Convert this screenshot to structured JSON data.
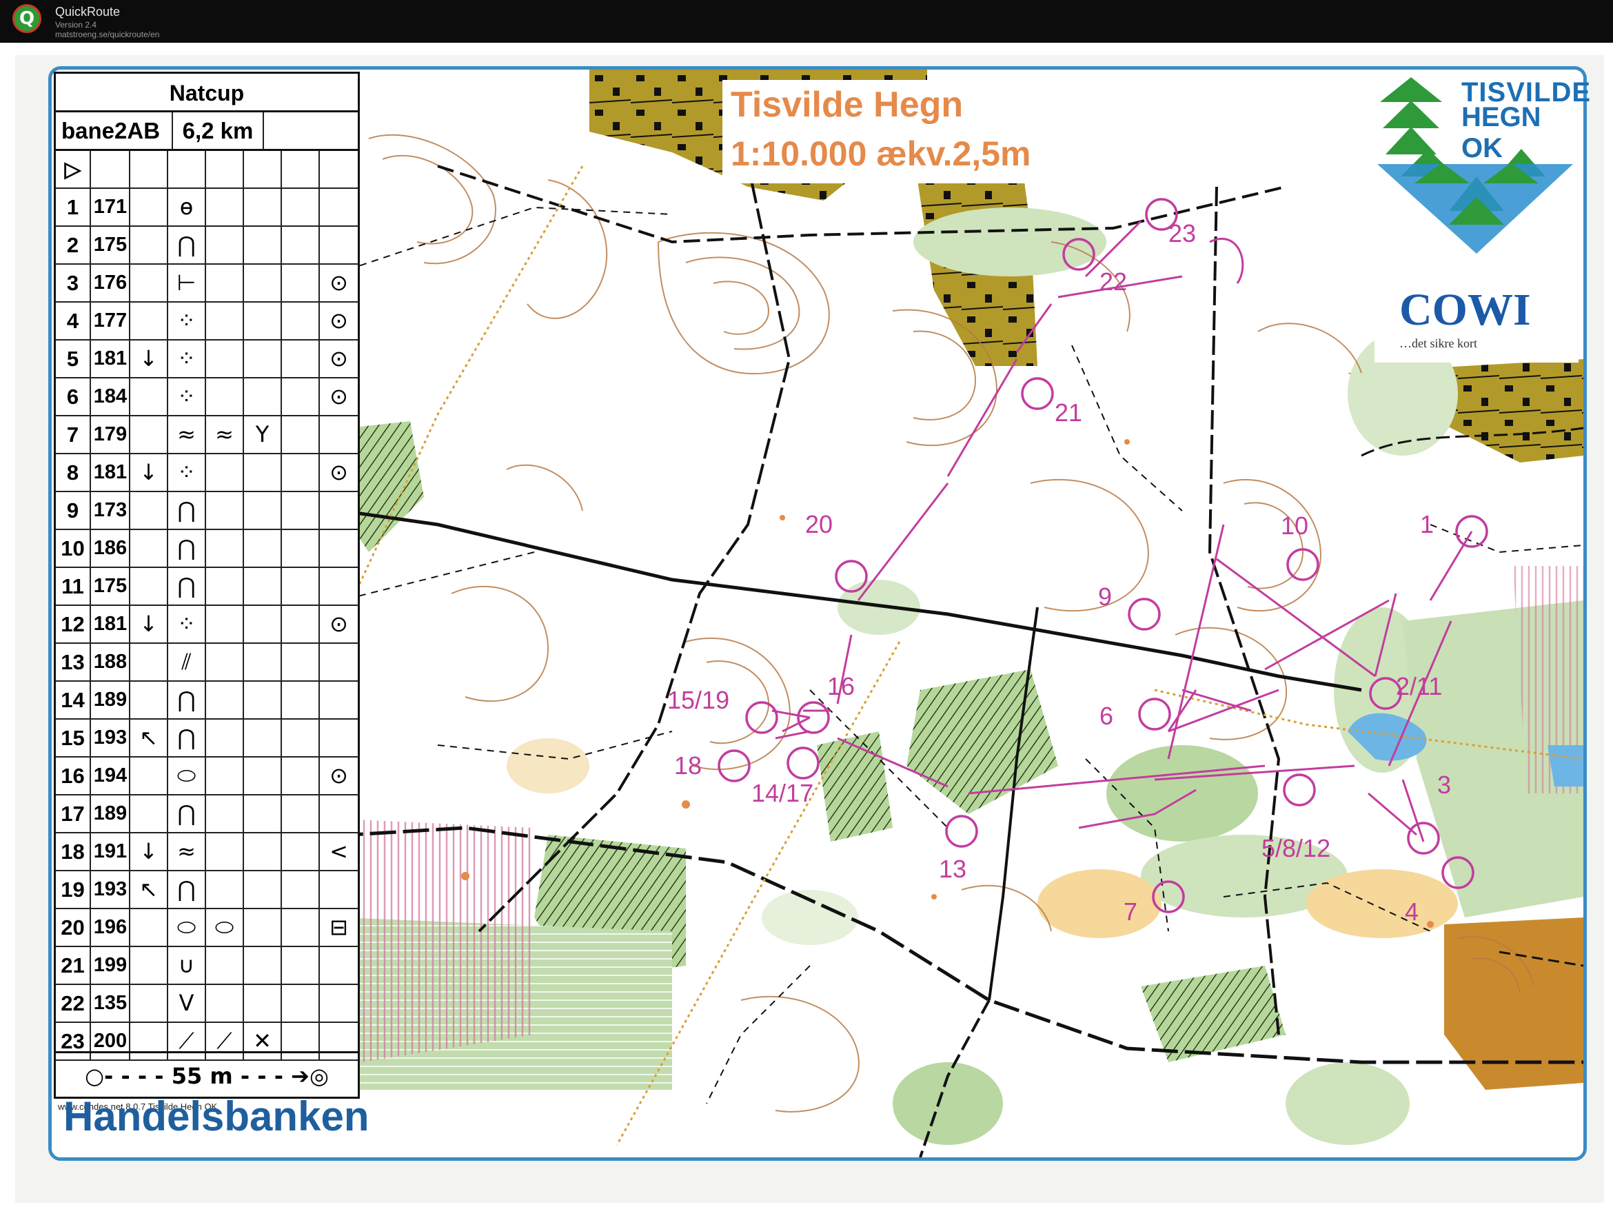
{
  "app": {
    "name": "QuickRoute",
    "version": "Version 2.4",
    "url": "matstroeng.se/quickroute/en",
    "logo_letter": "Q"
  },
  "map": {
    "title": "Tisvilde Hegn",
    "scale": "1:10.000 ækv.2,5m",
    "club_name_line1": "TISVILDE",
    "club_name_line2": "HEGN OK",
    "sponsor_top": "COWI",
    "sponsor_top_tagline": "…det sikre kort",
    "sponsor_bottom": "Handelsbanken",
    "copyright": "www.condes.net 8.0.7 Tisvilde Hegn OK",
    "colors": {
      "frame": "#3a8cc6",
      "course_overprint": "#c23d9e",
      "contour": "#b87a45",
      "green": "#a9cf8f",
      "yellow_open": "#f5c76e",
      "settlement": "#b19a2a",
      "water": "#6db5e5",
      "title_orange": "#e58a4a"
    }
  },
  "descriptions": {
    "event": "Natcup",
    "course": "bane2AB",
    "length": "6,2 km",
    "start_symbol": "▷",
    "controls": [
      {
        "num": "1",
        "code": "171",
        "c": "",
        "d": "ɵ",
        "e": "",
        "f": "",
        "g": "",
        "h": ""
      },
      {
        "num": "2",
        "code": "175",
        "c": "",
        "d": "⋂",
        "e": "",
        "f": "",
        "g": "",
        "h": ""
      },
      {
        "num": "3",
        "code": "176",
        "c": "",
        "d": "⊢",
        "e": "",
        "f": "",
        "g": "",
        "h": "⊙"
      },
      {
        "num": "4",
        "code": "177",
        "c": "",
        "d": "⁘",
        "e": "",
        "f": "",
        "g": "",
        "h": "⊙"
      },
      {
        "num": "5",
        "code": "181",
        "c": "↓",
        "d": "⁘",
        "e": "",
        "f": "",
        "g": "",
        "h": "⊙"
      },
      {
        "num": "6",
        "code": "184",
        "c": "",
        "d": "⁘",
        "e": "",
        "f": "",
        "g": "",
        "h": "⊙"
      },
      {
        "num": "7",
        "code": "179",
        "c": "",
        "d": "≈",
        "e": "≈",
        "f": "Y",
        "g": "",
        "h": ""
      },
      {
        "num": "8",
        "code": "181",
        "c": "↓",
        "d": "⁘",
        "e": "",
        "f": "",
        "g": "",
        "h": "⊙"
      },
      {
        "num": "9",
        "code": "173",
        "c": "",
        "d": "⋂",
        "e": "",
        "f": "",
        "g": "",
        "h": ""
      },
      {
        "num": "10",
        "code": "186",
        "c": "",
        "d": "⋂",
        "e": "",
        "f": "",
        "g": "",
        "h": ""
      },
      {
        "num": "11",
        "code": "175",
        "c": "",
        "d": "⋂",
        "e": "",
        "f": "",
        "g": "",
        "h": ""
      },
      {
        "num": "12",
        "code": "181",
        "c": "↓",
        "d": "⁘",
        "e": "",
        "f": "",
        "g": "",
        "h": "⊙"
      },
      {
        "num": "13",
        "code": "188",
        "c": "",
        "d": "⫽",
        "e": "",
        "f": "",
        "g": "",
        "h": ""
      },
      {
        "num": "14",
        "code": "189",
        "c": "",
        "d": "⋂",
        "e": "",
        "f": "",
        "g": "",
        "h": ""
      },
      {
        "num": "15",
        "code": "193",
        "c": "↖",
        "d": "⋂",
        "e": "",
        "f": "",
        "g": "",
        "h": ""
      },
      {
        "num": "16",
        "code": "194",
        "c": "",
        "d": "⬭",
        "e": "",
        "f": "",
        "g": "",
        "h": "⊙"
      },
      {
        "num": "17",
        "code": "189",
        "c": "",
        "d": "⋂",
        "e": "",
        "f": "",
        "g": "",
        "h": ""
      },
      {
        "num": "18",
        "code": "191",
        "c": "↓",
        "d": "≈",
        "e": "",
        "f": "",
        "g": "",
        "h": "<"
      },
      {
        "num": "19",
        "code": "193",
        "c": "↖",
        "d": "⋂",
        "e": "",
        "f": "",
        "g": "",
        "h": ""
      },
      {
        "num": "20",
        "code": "196",
        "c": "",
        "d": "⬭",
        "e": "⬭",
        "f": "",
        "g": "",
        "h": "⊟"
      },
      {
        "num": "21",
        "code": "199",
        "c": "",
        "d": "∪",
        "e": "",
        "f": "",
        "g": "",
        "h": ""
      },
      {
        "num": "22",
        "code": "135",
        "c": "",
        "d": "V",
        "e": "",
        "f": "",
        "g": "",
        "h": ""
      },
      {
        "num": "23",
        "code": "200",
        "c": "",
        "d": "⟋",
        "e": "⟋",
        "f": "✕",
        "g": "",
        "h": ""
      }
    ],
    "finish_line": "○- - - - 55 m - - - ➔◎"
  },
  "course": {
    "controls_on_map": [
      "1",
      "2/11",
      "3",
      "4",
      "5/8/12",
      "6",
      "7",
      "9",
      "10",
      "13",
      "14/17",
      "15/19",
      "16",
      "18",
      "20",
      "21",
      "22",
      "23"
    ]
  }
}
